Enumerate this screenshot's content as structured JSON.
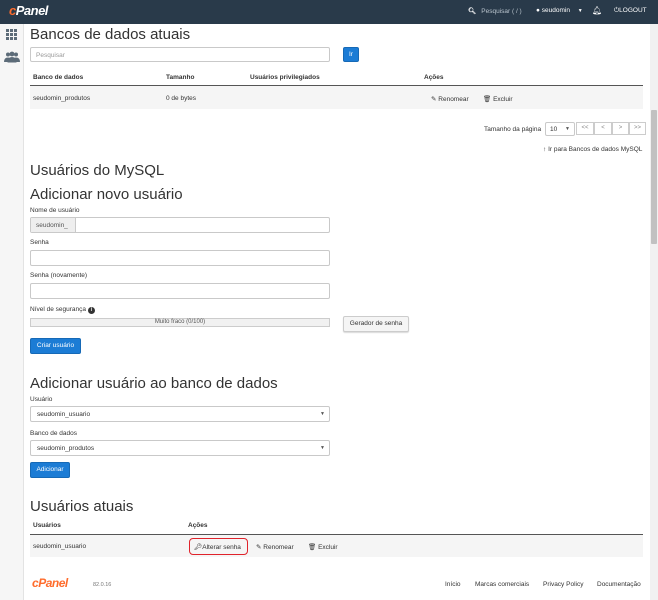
{
  "topbar": {
    "logo_c": "c",
    "logo_rest": "Panel",
    "search_placeholder": "Pesquisar ( / )",
    "user": "seudomin",
    "logout": "LOGOUT"
  },
  "databases": {
    "title": "Bancos de dados atuais",
    "search_placeholder": "Pesquisar",
    "go_label": "Ir",
    "columns": [
      "Banco de dados",
      "Tamanho",
      "Usuários privilegiados",
      "Ações"
    ],
    "rows": [
      {
        "name": "seudomin_produtos",
        "size": "0 de bytes",
        "users": "",
        "rename": "Renomear",
        "delete": "Excluir"
      }
    ],
    "page_size_label": "Tamanho da página",
    "page_size": "10",
    "pager": [
      "<<",
      "<",
      ">",
      ">>"
    ],
    "goto_link": "Ir para Bancos de dados MySQL"
  },
  "mysql_users": {
    "title": "Usuários do MySQL"
  },
  "add_user": {
    "title": "Adicionar novo usuário",
    "username_label": "Nome de usuário",
    "username_prefix": "seudomin_",
    "password_label": "Senha",
    "password_again_label": "Senha (novamente)",
    "strength_label": "Nível de segurança",
    "strength_text": "Muito fraco (0/100)",
    "strength_value": 0,
    "generator_label": "Gerador de senha",
    "create_label": "Criar usuário"
  },
  "add_user_to_db": {
    "title": "Adicionar usuário ao banco de dados",
    "user_label": "Usuário",
    "user_value": "seudomin_usuario",
    "db_label": "Banco de dados",
    "db_value": "seudomin_produtos",
    "add_label": "Adicionar"
  },
  "current_users": {
    "title": "Usuários atuais",
    "columns": [
      "Usuários",
      "Ações"
    ],
    "rows": [
      {
        "name": "seudomin_usuario",
        "change_password": "Alterar senha",
        "rename": "Renomear",
        "delete": "Excluir"
      }
    ]
  },
  "footer": {
    "version": "82.0.16",
    "links": [
      "Início",
      "Marcas comerciais",
      "Privacy Policy",
      "Documentação"
    ]
  },
  "colors": {
    "topbar": "#293a4a",
    "brand": "#ff6c2c",
    "primary": "#1c7cd5",
    "link": "#2a83c4",
    "highlight": "#e0232b"
  }
}
